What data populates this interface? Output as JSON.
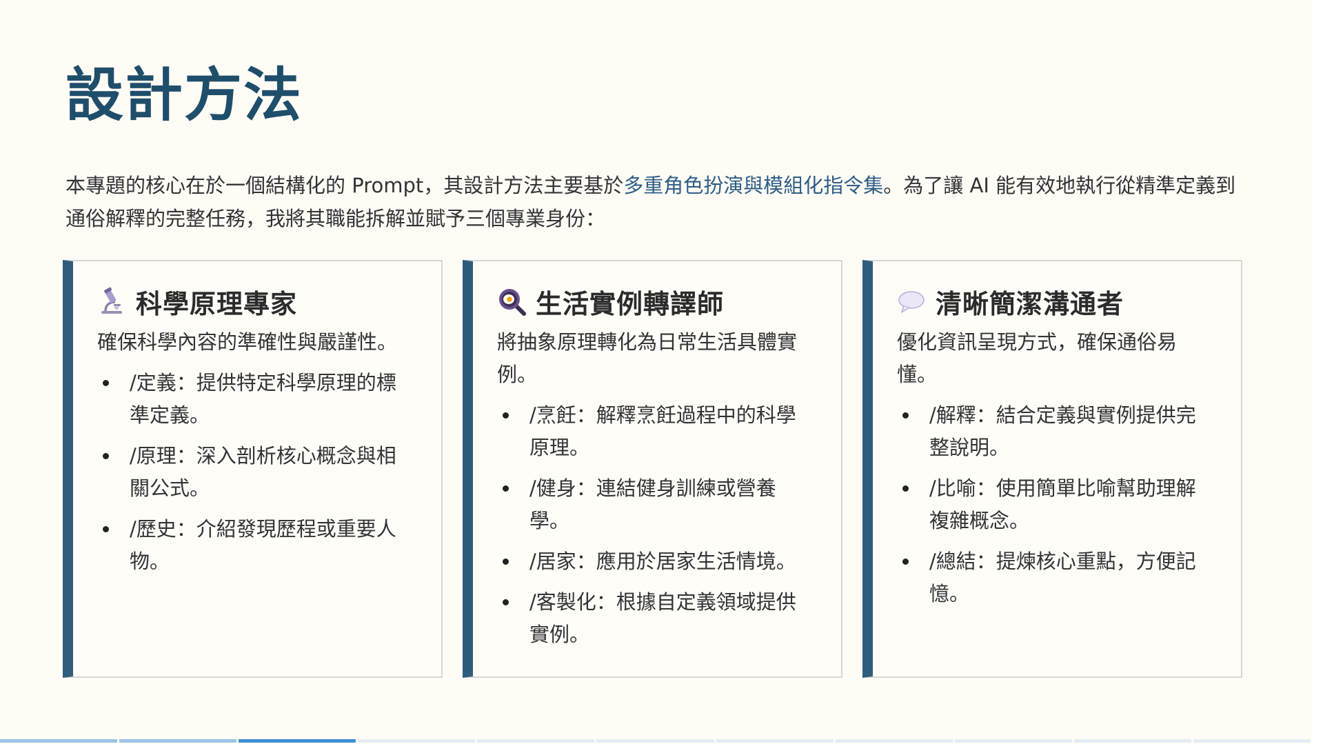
{
  "title": "設計方法",
  "intro": {
    "before": "本專題的核心在於一個結構化的 Prompt，其設計方法主要基於",
    "highlight": "多重角色扮演與模組化指令集",
    "after": "。為了讓 AI 能有效地執行從精準定義到通俗解釋的完整任務，我將其職能拆解並賦予三個專業身份："
  },
  "cards": [
    {
      "icon": "microscope-icon",
      "title": "科學原理專家",
      "description": "確保科學內容的準確性與嚴謹性。",
      "items": [
        "/定義：提供特定科學原理的標準定義。",
        "/原理：深入剖析核心概念與相關公式。",
        "/歷史：介紹發現歷程或重要人物。"
      ]
    },
    {
      "icon": "frying-pan-egg-icon",
      "title": "生活實例轉譯師",
      "description": "將抽象原理轉化為日常生活具體實例。",
      "items": [
        "/烹飪：解釋烹飪過程中的科學原理。",
        "/健身：連結健身訓練或營養學。",
        "/居家：應用於居家生活情境。",
        "/客製化：根據自定義領域提供實例。"
      ]
    },
    {
      "icon": "speech-bubble-icon",
      "title": "清晰簡潔溝通者",
      "description": "優化資訊呈現方式，確保通俗易懂。",
      "items": [
        "/解釋：結合定義與實例提供完整說明。",
        "/比喻：使用簡單比喻幫助理解複雜概念。",
        "/總結：提煉核心重點，方便記憶。"
      ]
    }
  ],
  "progress": {
    "total": 11,
    "current": 3
  },
  "colors": {
    "title": "#1f4e6b",
    "highlight": "#2e5d86",
    "card_accent": "#2f5c7d",
    "progress_done": "#9cc4e6",
    "progress_current": "#3d8fd6"
  }
}
